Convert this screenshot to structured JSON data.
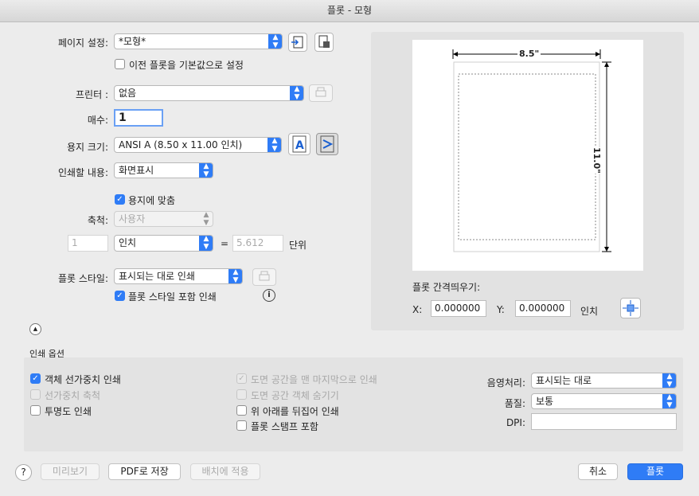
{
  "window": {
    "title": "플롯 - 모형"
  },
  "page_setup": {
    "label": "페이지 설정:",
    "value": "*모형*",
    "checkbox_label": "이전 플롯을 기본값으로 설정"
  },
  "printer": {
    "label": "프린터 :",
    "value": "없음"
  },
  "copies": {
    "label": "매수:",
    "value": "1"
  },
  "paper_size": {
    "label": "용지 크기:",
    "value": "ANSI A (8.50 x 11.00 인치)"
  },
  "plot_area": {
    "label": "인쇄할 내용:",
    "value": "화면표시"
  },
  "scale": {
    "fit_label": "용지에 맞춤",
    "label": "축척:",
    "value": "사용자",
    "left_value": "1",
    "unit": "인치",
    "equals": "=",
    "right_value": "5.612",
    "units_label": "단위"
  },
  "plot_style": {
    "label": "플롯 스타일:",
    "value": "표시되는 대로 인쇄",
    "checkbox_label": "플롯 스타일 포함 인쇄",
    "info_icon": "i"
  },
  "preview": {
    "width_label": "8.5\"",
    "height_label": "11.0\""
  },
  "offset": {
    "label": "플롯 간격띄우기:",
    "x_label": "X:",
    "x_value": "0.000000",
    "y_label": "Y:",
    "y_value": "0.000000",
    "unit": "인치"
  },
  "print_options": {
    "title": "인쇄 옵션",
    "col1": [
      "객체 선가중치 인쇄",
      "선가중치 축척",
      "투명도 인쇄"
    ],
    "col2": [
      "도면 공간을 맨 마지막으로 인쇄",
      "도면 공간 객체 숨기기",
      "위 아래를 뒤집어 인쇄",
      "플롯 스탬프 포함"
    ],
    "shading": {
      "label": "음영처리:",
      "value": "표시되는 대로"
    },
    "quality": {
      "label": "품질:",
      "value": "보통"
    },
    "dpi": {
      "label": "DPI:",
      "value": ""
    }
  },
  "footer": {
    "help": "?",
    "preview": "미리보기",
    "pdf": "PDF로 저장",
    "apply": "배치에 적용",
    "cancel": "취소",
    "plot": "플롯"
  },
  "colors": {
    "accent": "#2f7cf6"
  }
}
